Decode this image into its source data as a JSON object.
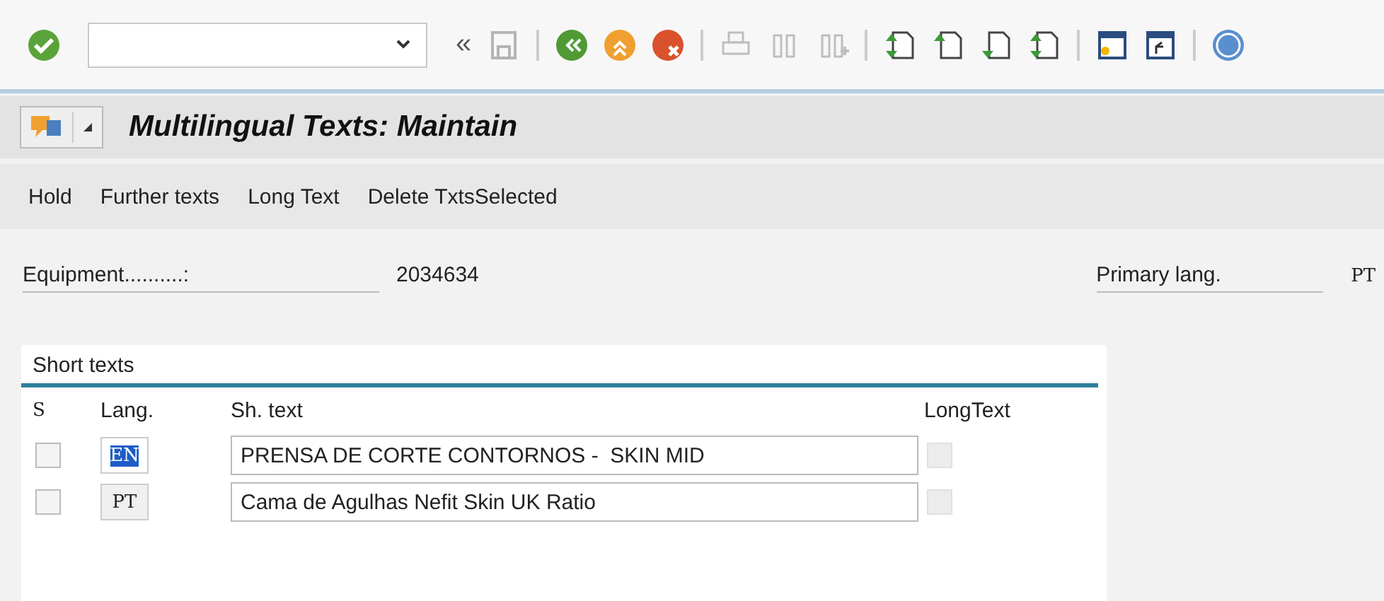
{
  "toolbar": [
    {
      "kind": "enter",
      "disabled": false
    },
    {
      "kind": "command-field"
    },
    {
      "kind": "text",
      "label": "«"
    },
    {
      "kind": "save",
      "disabled": true
    },
    {
      "kind": "separator"
    },
    {
      "kind": "back",
      "disabled": false
    },
    {
      "kind": "exit",
      "disabled": false
    },
    {
      "kind": "cancel",
      "disabled": false
    },
    {
      "kind": "separator"
    },
    {
      "kind": "print",
      "disabled": true
    },
    {
      "kind": "find",
      "disabled": true
    },
    {
      "kind": "find-next",
      "disabled": true
    },
    {
      "kind": "separator"
    },
    {
      "kind": "first-page",
      "disabled": false
    },
    {
      "kind": "previous-page",
      "disabled": false
    },
    {
      "kind": "next-page",
      "disabled": false
    },
    {
      "kind": "last-page",
      "disabled": false
    },
    {
      "kind": "separator"
    },
    {
      "kind": "new-session",
      "disabled": false
    },
    {
      "kind": "shortcut",
      "disabled": false
    },
    {
      "kind": "separator"
    },
    {
      "kind": "help",
      "disabled": false
    }
  ],
  "window": {
    "title": "Multilingual Texts: Maintain"
  },
  "menu": [
    "Hold",
    "Further texts",
    "Long Text",
    "Delete TxtsSelected"
  ],
  "header_fields": [
    {
      "label": "Equipment..........:",
      "value": "2034634",
      "kind": "sans"
    },
    {
      "label": "Primary lang.",
      "value": "PT",
      "kind": "mono"
    }
  ],
  "table": {
    "title": "Short texts",
    "columns": [
      "S",
      "Lang.",
      "Sh. text",
      "LongText"
    ],
    "rows": [
      {
        "checked": false,
        "lang": "EN",
        "lang_highlighted": true,
        "text": "PRENSA DE CORTE CONTORNOS -  SKIN MID",
        "long_text": false
      },
      {
        "checked": false,
        "lang": "PT",
        "lang_highlighted": false,
        "text": "Cama de Agulhas Nefit Skin UK Ratio",
        "long_text": false
      }
    ]
  }
}
